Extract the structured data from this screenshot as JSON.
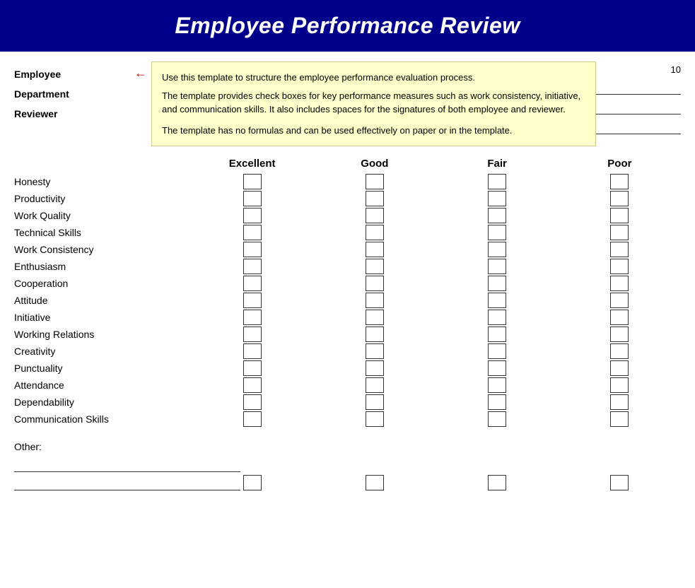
{
  "header": {
    "title": "Employee Performance Review"
  },
  "tooltip": {
    "text1": "Use this template to structure the employee performance evaluation process.",
    "text2": "The template provides check boxes for key performance measures such as work consistency, initiative, and communication skills. It also includes spaces for the signatures of both employee and reviewer.",
    "text3": "The template has no formulas and can be used effectively on paper or in the template."
  },
  "employee_info": {
    "employee_label": "Employee",
    "department_label": "Department",
    "reviewer_label": "Reviewer"
  },
  "page_number": "10",
  "ratings": {
    "headers": [
      "Excellent",
      "Good",
      "Fair",
      "Poor"
    ],
    "criteria": [
      "Honesty",
      "Productivity",
      "Work Quality",
      "Technical Skills",
      "Work Consistency",
      "Enthusiasm",
      "Cooperation",
      "Attitude",
      "Initiative",
      "Working Relations",
      "Creativity",
      "Punctuality",
      "Attendance",
      "Dependability",
      "Communication Skills"
    ]
  },
  "other_label": "Other:"
}
